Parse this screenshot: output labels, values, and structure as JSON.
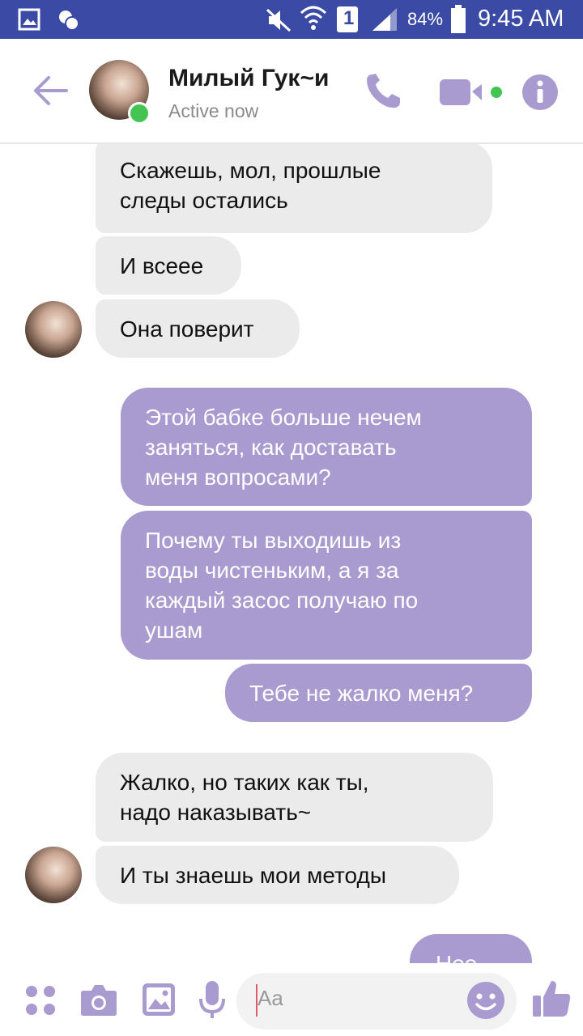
{
  "status_bar": {
    "battery": "84%",
    "time": "9:45 AM",
    "sim": "1",
    "icons": [
      "gallery-icon",
      "notification-icon",
      "mute-icon",
      "wifi-icon",
      "sim-icon",
      "signal-icon",
      "battery-icon"
    ]
  },
  "header": {
    "contact_name": "Милый Гук~и",
    "status": "Active now",
    "icons": [
      "back-arrow-icon",
      "phone-icon",
      "video-icon",
      "info-icon"
    ]
  },
  "colors": {
    "accent": "#a99acf",
    "status_bar": "#3a4aa5",
    "incoming_bubble": "#ebebeb",
    "online": "#44c553"
  },
  "messages": [
    {
      "from": "contact",
      "lines": [
        "Скажешь, мол, прошлые",
        "следы остались"
      ]
    },
    {
      "from": "contact",
      "lines": [
        "И всеее"
      ]
    },
    {
      "from": "contact",
      "lines": [
        "Она поверит"
      ]
    },
    {
      "from": "me",
      "lines": [
        "Этой бабке больше нечем",
        "заняться, как доставать",
        "меня вопросами?"
      ]
    },
    {
      "from": "me",
      "lines": [
        "Почему ты выходишь из",
        "воды чистеньким, а я за",
        "каждый засос получаю по",
        "ушам"
      ]
    },
    {
      "from": "me",
      "lines": [
        "Тебе не жалко меня?"
      ]
    },
    {
      "from": "contact",
      "lines": [
        "Жалко, но таких как ты,",
        "надо наказывать~"
      ]
    },
    {
      "from": "contact",
      "lines": [
        "И ты знаешь мои методы"
      ]
    },
    {
      "from": "me",
      "lines": [
        "Нее..."
      ]
    }
  ],
  "composer": {
    "placeholder": "Aa",
    "icons": [
      "apps-icon",
      "camera-icon",
      "image-icon",
      "mic-icon",
      "emoji-icon",
      "thumbs-up-icon"
    ]
  }
}
